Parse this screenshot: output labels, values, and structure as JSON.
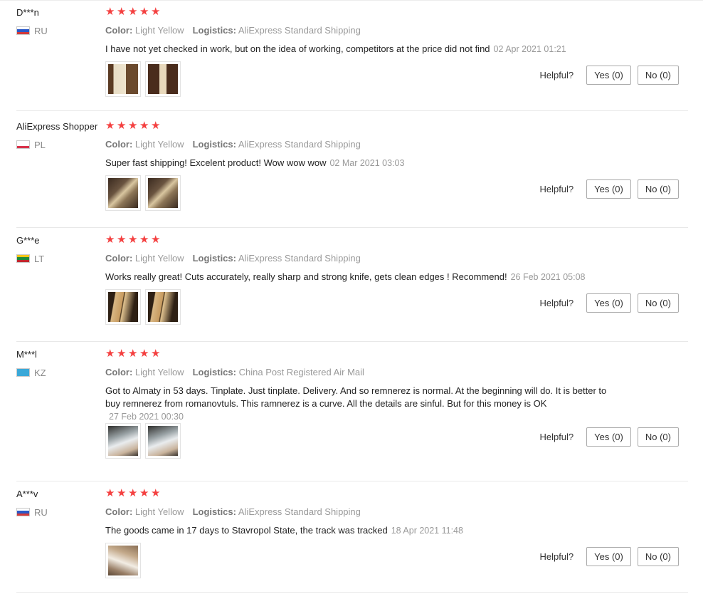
{
  "reviews": [
    {
      "name": "D***n",
      "country": "RU",
      "flag": [
        "#ffffff",
        "#2a59c8",
        "#d33a3a"
      ],
      "color_label": "Color:",
      "color_value": "Light Yellow",
      "logistics_label": "Logistics:",
      "logistics_value": "AliExpress Standard Shipping",
      "text": "I have not yet checked in work, but on the idea of working, competitors at the price did not find",
      "date": "02 Apr 2021 01:21",
      "helpful_label": "Helpful?",
      "yes": "Yes (0)",
      "no": "No (0)",
      "photos": [
        "box-with-cutter-photo",
        "cross-shaped-part-photo"
      ]
    },
    {
      "name": "AliExpress Shopper",
      "country": "PL",
      "flag": [
        "#ffffff",
        "#ffffff",
        "#d8324a"
      ],
      "color_label": "Color:",
      "color_value": "Light Yellow",
      "logistics_label": "Logistics:",
      "logistics_value": "AliExpress Standard Shipping",
      "text": "Super fast shipping! Excelent product! Wow wow wow",
      "date": "02 Mar 2021 03:03",
      "helpful_label": "Helpful?",
      "yes": "Yes (0)",
      "no": "No (0)",
      "photos": [
        "wooden-tool-photo",
        "wooden-tool-photo"
      ]
    },
    {
      "name": "G***e",
      "country": "LT",
      "flag": [
        "#f5c518",
        "#1f8a3a",
        "#c1272d"
      ],
      "color_label": "Color:",
      "color_value": "Light Yellow",
      "logistics_label": "Logistics:",
      "logistics_value": "AliExpress Standard Shipping",
      "text": "Works really great! Cuts accurately, really sharp and strong knife, gets clean edges ! Recommend!",
      "date": "26 Feb 2021 05:08",
      "helpful_label": "Helpful?",
      "yes": "Yes (0)",
      "no": "No (0)",
      "photos": [
        "cut-edges-photo",
        "cut-edges-photo"
      ]
    },
    {
      "name": "M***l",
      "country": "KZ",
      "flag": [
        "#3aa8d8",
        "#3aa8d8",
        "#3aa8d8"
      ],
      "color_label": "Color:",
      "color_value": "Light Yellow",
      "logistics_label": "Logistics:",
      "logistics_value": "China Post Registered Air Mail",
      "text": "Got to Almaty in 53 days. Tinplate. Just tinplate. Delivery. And so remnerez is normal. At the beginning will do. It is better to buy remnerez from romanovtuls. This ramnerez is a curve. All the details are sinful. But for this money is OK",
      "date": "27 Feb 2021 00:30",
      "helpful_label": "Helpful?",
      "yes": "Yes (0)",
      "no": "No (0)",
      "photos": [
        "package-in-hand-photo",
        "package-in-hand-photo"
      ]
    },
    {
      "name": "A***v",
      "country": "RU",
      "flag": [
        "#ffffff",
        "#2a59c8",
        "#d33a3a"
      ],
      "color_label": "Color:",
      "color_value": "Light Yellow",
      "logistics_label": "Logistics:",
      "logistics_value": "AliExpress Standard Shipping",
      "text": "The goods came in 17 days to Stavropol State, the track was tracked",
      "date": "18 Apr 2021 11:48",
      "helpful_label": "Helpful?",
      "yes": "Yes (0)",
      "no": "No (0)",
      "photos": [
        "item-on-floor-photo"
      ]
    }
  ],
  "star_count": 5,
  "star_color": "#f44040"
}
